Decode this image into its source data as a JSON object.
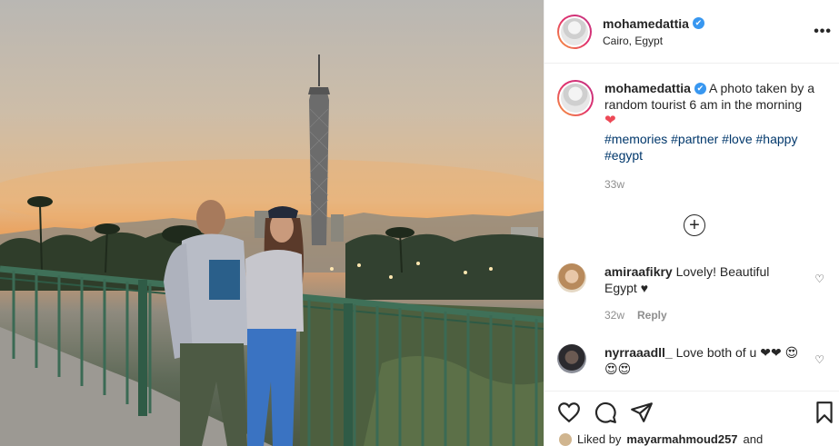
{
  "post": {
    "username": "mohamedattia",
    "location": "Cairo, Egypt",
    "caption_text": "A photo taken by a random tourist 6 am in the morning",
    "caption_emoji": "❤",
    "hashtags": "#memories #partner #love #happy #egypt",
    "age": "33w"
  },
  "icons": {
    "verified": "✔",
    "more": "•••",
    "load_more": "+",
    "comment_like": "♡"
  },
  "comments": [
    {
      "username": "amiraafikry",
      "text": "Lovely! Beautiful Egypt ♥",
      "age": "32w",
      "reply": "Reply"
    },
    {
      "username": "nyrraaadll_",
      "text": "Love both of u ❤❤ 😍😍😍",
      "age": "",
      "reply": ""
    }
  ],
  "likes": {
    "prefix": "Liked by",
    "user": "mayarmahmoud257",
    "suffix": "and"
  },
  "colors": {
    "verified": "#3897f0",
    "hashtag": "#00376b",
    "heart": "#ed4956",
    "muted": "#8e8e8e"
  }
}
